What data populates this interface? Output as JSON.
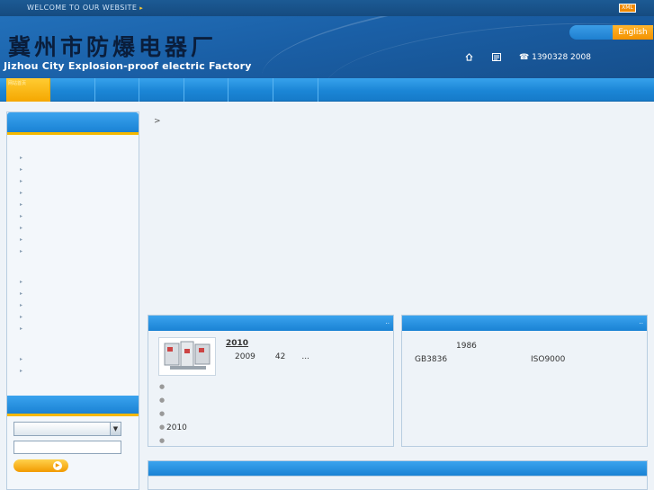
{
  "topbar": {
    "welcome": "WELCOME TO OUR WEBSITE",
    "arrow": "▸",
    "xml_badge": "XML"
  },
  "header": {
    "brand_cn": "冀州市防爆电器厂",
    "brand_en": "Jizhou City Explosion-proof electric Factory",
    "language_button": "English",
    "home_icon": "home-icon",
    "bookmark_icon": "bookmark-icon",
    "phone_icon": "☎",
    "phone": "1390328 2008"
  },
  "nav": {
    "active_label": "网站首页",
    "item_count": 7
  },
  "sidebar": {
    "arrow_glyph": "▸",
    "group1_count": 9,
    "group2_count": 5,
    "group3_count": 2,
    "search_submit_icon": "▶"
  },
  "breadcrumb": {
    "separator": ">"
  },
  "news_panel": {
    "more": "..",
    "headline_year": "2010",
    "summary_year": "2009",
    "summary_num": "42",
    "ellipsis": "...",
    "list": [
      "",
      "",
      "",
      "2010",
      ""
    ]
  },
  "about_panel": {
    "more": "..",
    "year": "1986",
    "standard": "GB3836",
    "iso": "ISO9000"
  },
  "colors": {
    "accent_blue": "#1a82d4",
    "accent_orange": "#f39200",
    "header_dark": "#164f8c"
  }
}
